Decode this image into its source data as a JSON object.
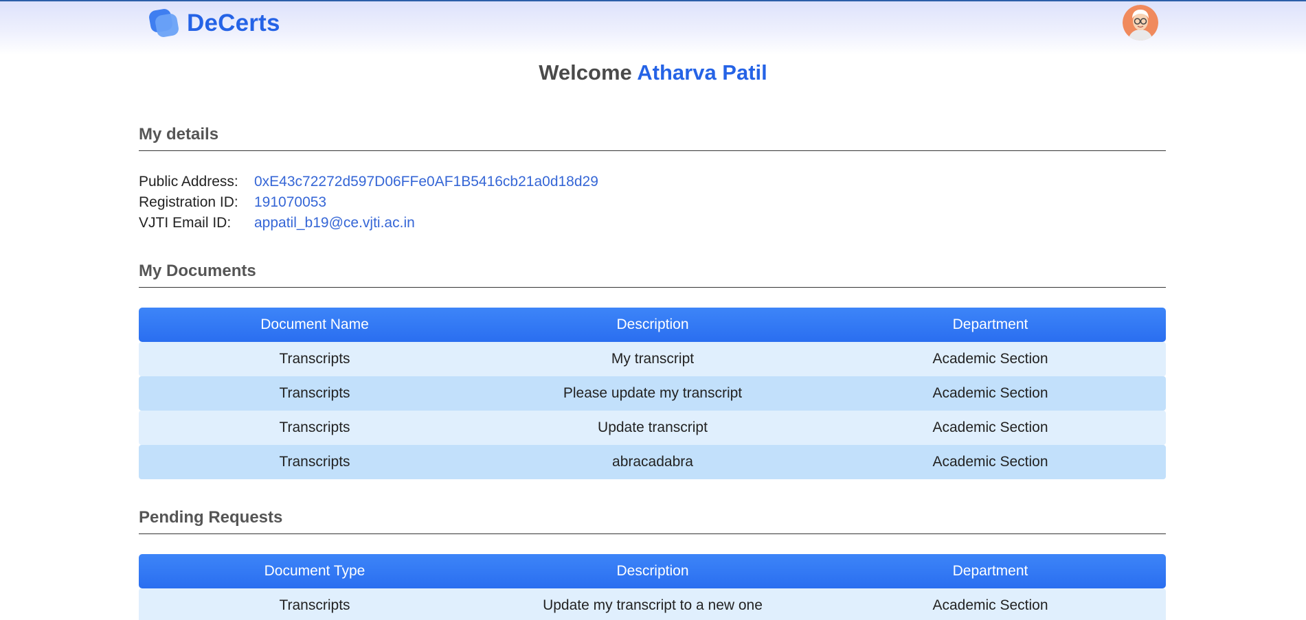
{
  "app": {
    "brand": "DeCerts"
  },
  "header": {
    "welcome_prefix": "Welcome",
    "user_name": "Atharva Patil"
  },
  "my_details": {
    "title": "My details",
    "rows": [
      {
        "label": "Public Address:",
        "value": "0xE43c72272d597D06FFe0AF1B5416cb21a0d18d29"
      },
      {
        "label": "Registration ID:",
        "value": "191070053"
      },
      {
        "label": "VJTI Email ID:",
        "value": "appatil_b19@ce.vjti.ac.in"
      }
    ]
  },
  "my_documents": {
    "title": "My Documents",
    "columns": [
      "Document Name",
      "Description",
      "Department"
    ],
    "rows": [
      [
        "Transcripts",
        "My transcript",
        "Academic Section"
      ],
      [
        "Transcripts",
        "Please update my transcript",
        "Academic Section"
      ],
      [
        "Transcripts",
        "Update transcript",
        "Academic Section"
      ],
      [
        "Transcripts",
        "abracadabra",
        "Academic Section"
      ]
    ]
  },
  "pending_requests": {
    "title": "Pending Requests",
    "columns": [
      "Document Type",
      "Description",
      "Department"
    ],
    "rows": [
      [
        "Transcripts",
        "Update my transcript to a new one",
        "Academic Section"
      ]
    ]
  },
  "colors": {
    "accent": "#2563e6",
    "table_header": "#2a6ef0",
    "row_light": "#e0effd",
    "row_dark": "#c2e0fb"
  },
  "icons": {
    "logo": "decerts-logo-icon",
    "avatar": "user-avatar"
  }
}
